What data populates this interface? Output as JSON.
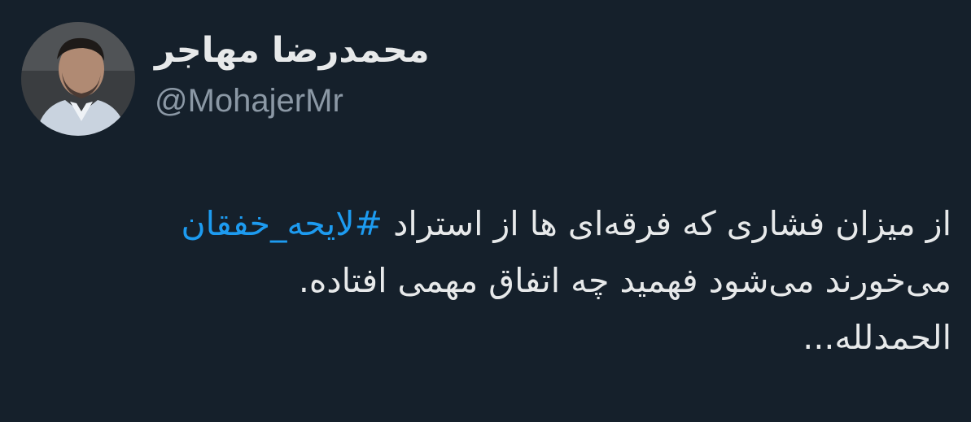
{
  "tweet": {
    "author": {
      "avatar_icon": "user-avatar-photo",
      "display_name": "محمدرضا مهاجر",
      "handle": "@MohajerMr"
    },
    "body": {
      "line1_text": "از میزان فشاری که فرقه‌ای ها از استراد ",
      "hashtag": "#لایحه_خفقان",
      "line2": "می‌خورند می‌شود فهمید چه اتفاق مهمی افتاده.",
      "line3": "الحمدلله..."
    }
  },
  "colors": {
    "background": "#15202b",
    "primary_text": "#e7e9ea",
    "secondary_text": "#8b98a5",
    "link": "#1d9bf0"
  }
}
